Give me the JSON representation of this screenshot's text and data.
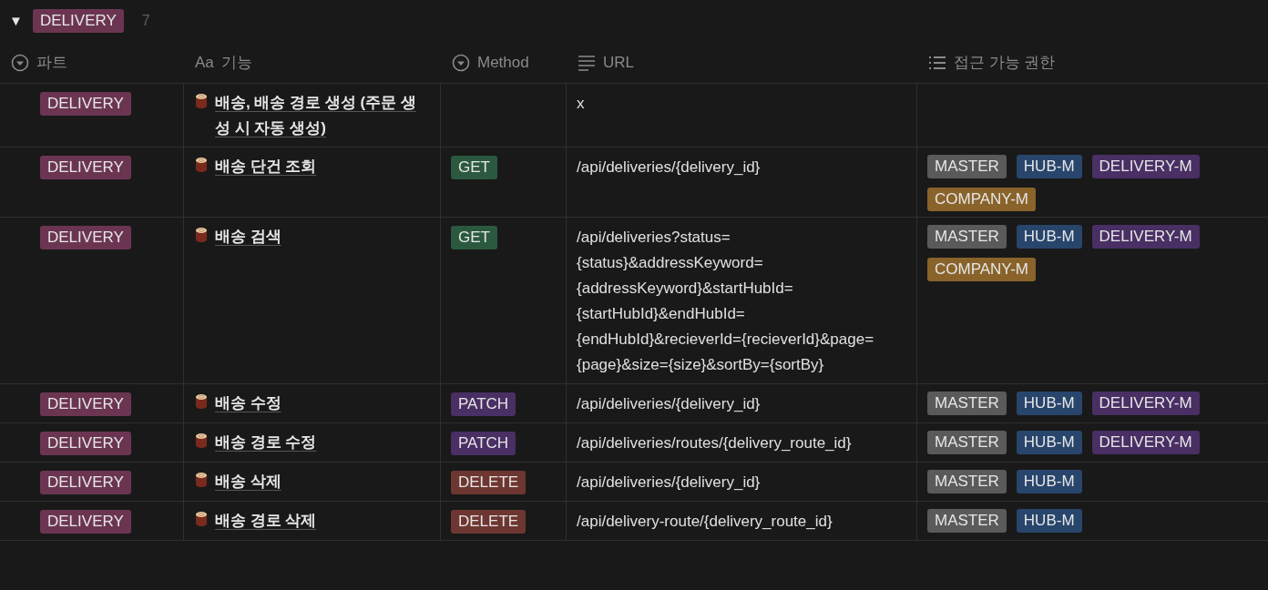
{
  "group": {
    "expanded": true,
    "toggle": "▼",
    "tag": {
      "label": "DELIVERY",
      "color": "#6b3552"
    },
    "count": "7"
  },
  "columns": [
    {
      "kind": "select",
      "label": "파트"
    },
    {
      "kind": "title",
      "label": "기능",
      "prefix": "Aa"
    },
    {
      "kind": "select",
      "label": "Method"
    },
    {
      "kind": "text",
      "label": "URL"
    },
    {
      "kind": "multi",
      "label": "접근 가능 권한"
    }
  ],
  "rows": [
    {
      "part": {
        "label": "DELIVERY",
        "color": "#6b3552"
      },
      "title": "배송, 배송 경로 생성 (주문 생성 시 자동 생성)",
      "url": "x",
      "roles": []
    },
    {
      "part": {
        "label": "DELIVERY",
        "color": "#6b3552"
      },
      "title": "배송 단건 조회",
      "method": {
        "label": "GET",
        "color": "#2b593f"
      },
      "url": "/api/deliveries/{delivery_id}",
      "roles": [
        {
          "label": "MASTER",
          "color": "#5a5a5a"
        },
        {
          "label": "HUB-M",
          "color": "#28456c"
        },
        {
          "label": "DELIVERY-M",
          "color": "#492f64"
        },
        {
          "label": "COMPANY-M",
          "color": "#89632a"
        }
      ]
    },
    {
      "part": {
        "label": "DELIVERY",
        "color": "#6b3552"
      },
      "title": "배송 검색",
      "method": {
        "label": "GET",
        "color": "#2b593f"
      },
      "url": "/api/deliveries?status={status}&addressKeyword={addressKeyword}&startHubId={startHubId}&endHubId={endHubId}&recieverId={recieverId}&page={page}&size={size}&sortBy={sortBy}",
      "roles": [
        {
          "label": "MASTER",
          "color": "#5a5a5a"
        },
        {
          "label": "HUB-M",
          "color": "#28456c"
        },
        {
          "label": "DELIVERY-M",
          "color": "#492f64"
        },
        {
          "label": "COMPANY-M",
          "color": "#89632a"
        }
      ]
    },
    {
      "part": {
        "label": "DELIVERY",
        "color": "#6b3552"
      },
      "title": "배송 수정",
      "method": {
        "label": "PATCH",
        "color": "#492f64"
      },
      "url": "/api/deliveries/{delivery_id}",
      "roles": [
        {
          "label": "MASTER",
          "color": "#5a5a5a"
        },
        {
          "label": "HUB-M",
          "color": "#28456c"
        },
        {
          "label": "DELIVERY-M",
          "color": "#492f64"
        }
      ]
    },
    {
      "part": {
        "label": "DELIVERY",
        "color": "#6b3552"
      },
      "title": "배송 경로 수정",
      "method": {
        "label": "PATCH",
        "color": "#492f64"
      },
      "url": "/api/deliveries/routes/{delivery_route_id}",
      "roles": [
        {
          "label": "MASTER",
          "color": "#5a5a5a"
        },
        {
          "label": "HUB-M",
          "color": "#28456c"
        },
        {
          "label": "DELIVERY-M",
          "color": "#492f64"
        }
      ]
    },
    {
      "part": {
        "label": "DELIVERY",
        "color": "#6b3552"
      },
      "title": "배송 삭제",
      "method": {
        "label": "DELETE",
        "color": "#6e3630"
      },
      "url": "/api/deliveries/{delivery_id}",
      "roles": [
        {
          "label": "MASTER",
          "color": "#5a5a5a"
        },
        {
          "label": "HUB-M",
          "color": "#28456c"
        }
      ]
    },
    {
      "part": {
        "label": "DELIVERY",
        "color": "#6b3552"
      },
      "title": "배송 경로 삭제",
      "method": {
        "label": "DELETE",
        "color": "#6e3630"
      },
      "url": "/api/delivery-route/{delivery_route_id}",
      "roles": [
        {
          "label": "MASTER",
          "color": "#5a5a5a"
        },
        {
          "label": "HUB-M",
          "color": "#28456c"
        }
      ]
    }
  ]
}
